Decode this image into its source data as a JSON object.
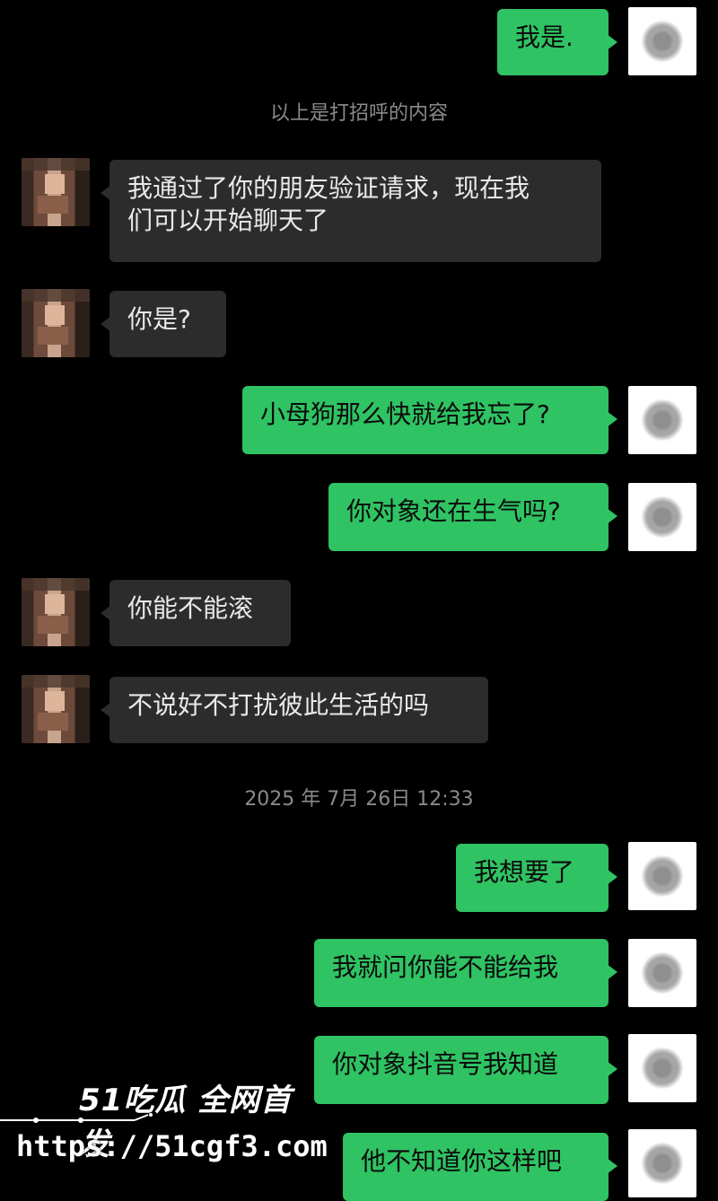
{
  "messages": [
    {
      "side": "me",
      "text": "我是."
    },
    {
      "side": "system",
      "text": "以上是打招呼的内容"
    },
    {
      "side": "her",
      "line1": "我通过了你的朋友验证请求，现在我",
      "line2": "们可以开始聊天了"
    },
    {
      "side": "her",
      "text": "你是?"
    },
    {
      "side": "me",
      "text": "小母狗那么快就给我忘了?"
    },
    {
      "side": "me",
      "text": "你对象还在生气吗?"
    },
    {
      "side": "her",
      "text": "你能不能滚"
    },
    {
      "side": "her",
      "text": "不说好不打扰彼此生活的吗"
    },
    {
      "side": "system",
      "text": "2025 年 7月 26日 12:33"
    },
    {
      "side": "me",
      "text": "我想要了"
    },
    {
      "side": "me",
      "text": "我就问你能不能给我"
    },
    {
      "side": "me",
      "text": "你对象抖音号我知道"
    },
    {
      "side": "me",
      "text": "他不知道你这样吧"
    }
  ],
  "watermark": {
    "line1": "51吃瓜 全网首发",
    "line2": "https://51cgf3.com"
  },
  "colors": {
    "background": "#000000",
    "my_bubble": "#2fc363",
    "their_bubble": "#2c2c2c",
    "system_text": "#8a8a8a"
  }
}
